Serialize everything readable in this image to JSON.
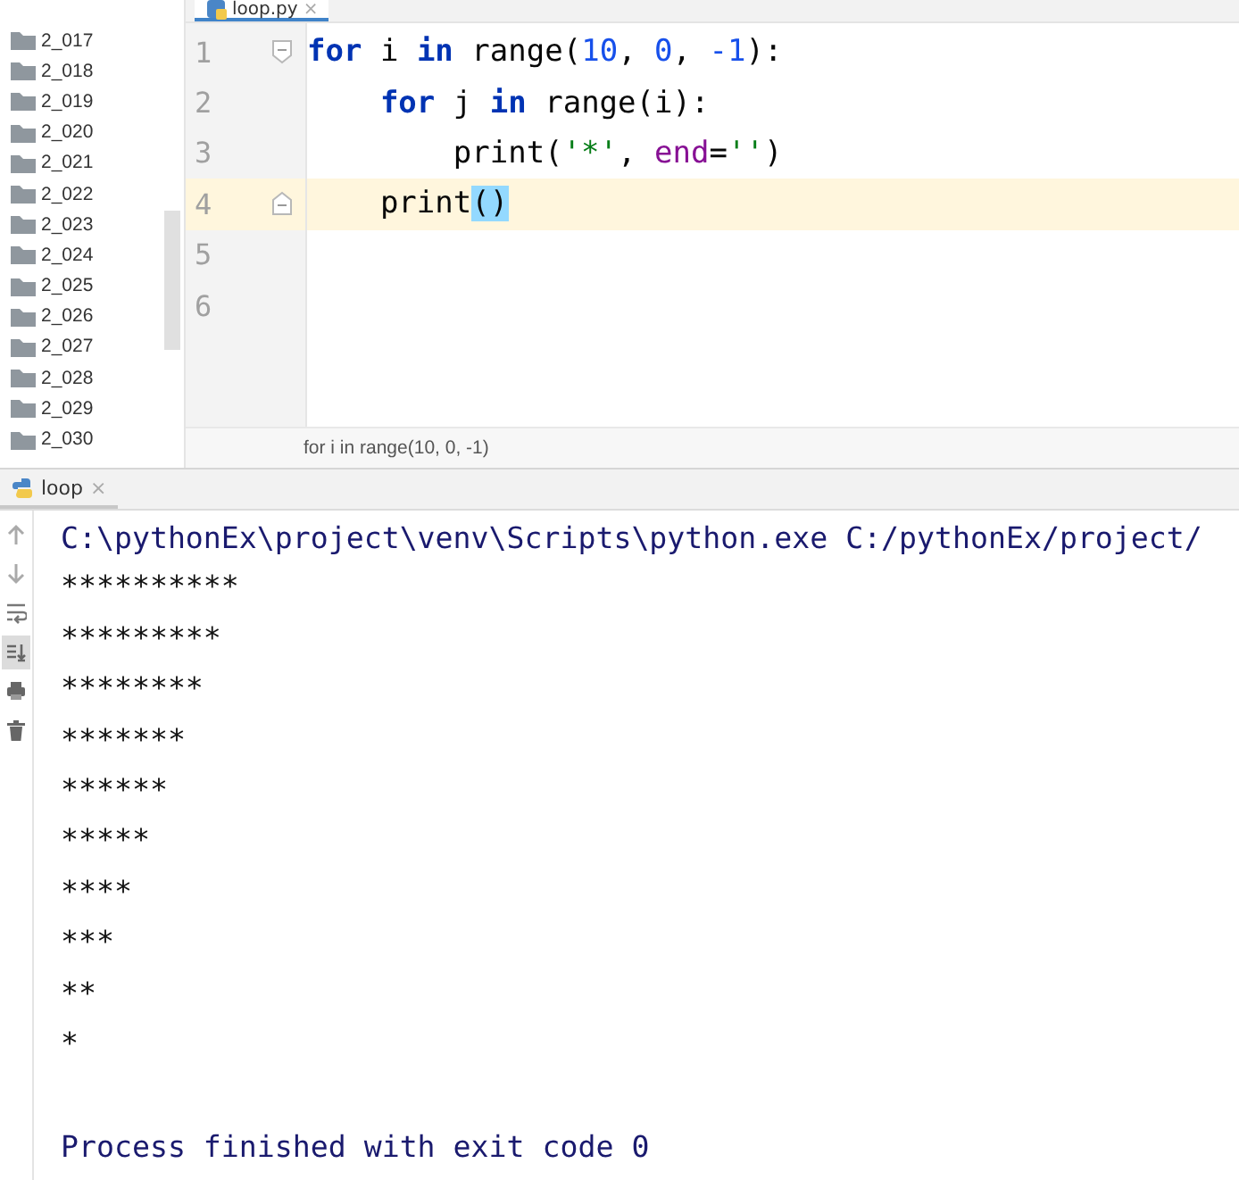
{
  "project_tree": {
    "items": [
      {
        "label": "2_017"
      },
      {
        "label": "2_018"
      },
      {
        "label": "2_019"
      },
      {
        "label": "2_020"
      },
      {
        "label": "2_021"
      },
      {
        "label": "2_022"
      },
      {
        "label": "2_023"
      },
      {
        "label": "2_024"
      },
      {
        "label": "2_025"
      },
      {
        "label": "2_026"
      },
      {
        "label": "2_027"
      },
      {
        "label": "2_028"
      },
      {
        "label": "2_029"
      },
      {
        "label": "2_030"
      }
    ]
  },
  "editor": {
    "tab": {
      "label": "loop.py",
      "close": "×",
      "selected": true
    },
    "lines": [
      {
        "number": "1",
        "current": false,
        "fold_marker": true,
        "tokens": [
          {
            "kind": "keyword",
            "text": "for"
          },
          {
            "kind": "plain",
            "text": " i "
          },
          {
            "kind": "keyword",
            "text": "in"
          },
          {
            "kind": "plain",
            "text": " range("
          },
          {
            "kind": "number",
            "text": "10"
          },
          {
            "kind": "plain",
            "text": ", "
          },
          {
            "kind": "number",
            "text": "0"
          },
          {
            "kind": "plain",
            "text": ", "
          },
          {
            "kind": "number",
            "text": "-1"
          },
          {
            "kind": "plain",
            "text": "):"
          }
        ]
      },
      {
        "number": "2",
        "current": false,
        "fold_marker": false,
        "tokens": [
          {
            "kind": "keyword",
            "text": "    for"
          },
          {
            "kind": "plain",
            "text": " j "
          },
          {
            "kind": "keyword",
            "text": "in"
          },
          {
            "kind": "plain",
            "text": " range(i):"
          }
        ]
      },
      {
        "number": "3",
        "current": false,
        "fold_marker": false,
        "tokens": [
          {
            "kind": "plain",
            "text": "        print("
          },
          {
            "kind": "string",
            "text": "'*'"
          },
          {
            "kind": "plain",
            "text": ", "
          },
          {
            "kind": "param",
            "text": "end"
          },
          {
            "kind": "plain",
            "text": "="
          },
          {
            "kind": "string",
            "text": "''"
          },
          {
            "kind": "plain",
            "text": ")"
          }
        ]
      },
      {
        "number": "4",
        "current": true,
        "fold_marker": true,
        "tokens": [
          {
            "kind": "plain",
            "text": "    print"
          },
          {
            "kind": "match",
            "text": "()"
          }
        ]
      },
      {
        "number": "5",
        "current": false,
        "fold_marker": false
      },
      {
        "number": "6",
        "current": false,
        "fold_marker": false
      }
    ],
    "breadcrumb": "for i in range(10, 0, -1)"
  },
  "run_panel": {
    "tab": {
      "label": "loop",
      "close": "×",
      "selected": true
    },
    "tools": [
      {
        "kind": "up",
        "selected": false
      },
      {
        "kind": "down",
        "selected": false
      },
      {
        "kind": "wrap",
        "selected": false
      },
      {
        "kind": "scroll-end",
        "selected": true
      },
      {
        "kind": "print",
        "selected": false
      },
      {
        "kind": "trash",
        "selected": false
      }
    ],
    "output": [
      {
        "kind": "system",
        "text": "C:\\pythonEx\\project\\venv\\Scripts\\python.exe C:/pythonEx/project/"
      },
      {
        "kind": "stdout",
        "text": "**********\n*********\n********\n*******\n******\n*****\n****\n***\n**\n*"
      },
      {
        "kind": "blank"
      },
      {
        "kind": "system",
        "text": "Process finished with exit code 0"
      }
    ]
  }
}
